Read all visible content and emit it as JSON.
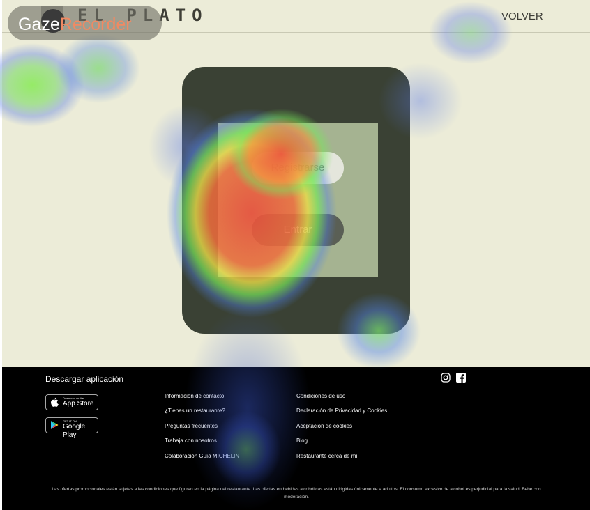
{
  "header": {
    "logo_text": "EL PLATO",
    "back_label": "VOLVER"
  },
  "overlay": {
    "brand_word1": "Gaze",
    "brand_word2": "Recorder"
  },
  "modal": {
    "register_label": "Registrarse",
    "login_label": "Entrar"
  },
  "footer": {
    "download_title": "Descargar aplicación",
    "app_store": {
      "small": "Download on the",
      "big": "App Store"
    },
    "google_play": {
      "small": "GET IT ON",
      "big": "Google Play"
    },
    "links_col1": [
      "Información de contacto",
      "¿Tienes un restaurante?",
      "Preguntas frecuentes",
      "Trabaja con nosotros",
      "Colaboración Guía MICHELIN"
    ],
    "links_col2": [
      "Condiciones de uso",
      "Declaración de Privacidad y Cookies",
      "Aceptación de cookies",
      "Blog",
      "Restaurante cerca de mí"
    ],
    "disclaimer": "Las ofertas promocionales están sujetas a las condiciones que figuran en la página del restaurante. Las ofertas en bebidas alcohólicas están dirigidas únicamente a adultos. El consumo excesivo de alcohol es perjudicial para la salud. Bebe con moderación."
  },
  "colors": {
    "page_bg": "#ececd8",
    "modal_bg": "#3a4134",
    "footer_bg": "#000000",
    "brand_accent": "#f08a63"
  },
  "icons": [
    "instagram-icon",
    "facebook-icon",
    "apple-icon",
    "google-play-icon"
  ]
}
